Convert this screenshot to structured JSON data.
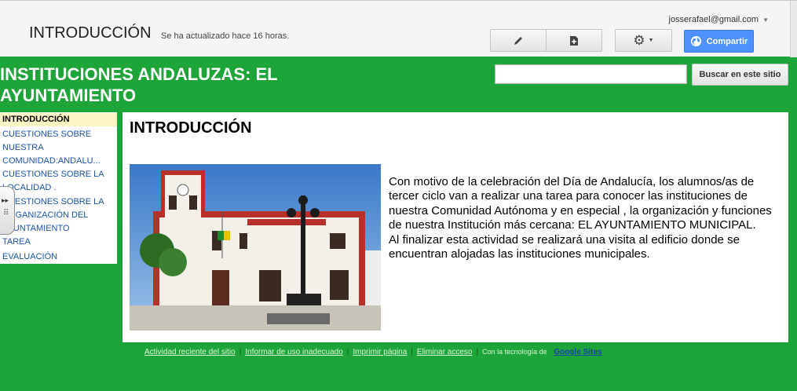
{
  "header": {
    "page_title": "INTRODUCCIÓN",
    "updated_text": "Se ha actualizado hace 16 horas.",
    "user_email": "josserafael@gmail.com",
    "share_label": "Compartir"
  },
  "site": {
    "title": "INSTITUCIONES ANDALUZAS: EL AYUNTAMIENTO",
    "search_button": "Buscar en este sitio",
    "search_value": ""
  },
  "sidebar": {
    "items": [
      {
        "label": "INTRODUCCIÓN",
        "active": true
      },
      {
        "label": "CUESTIONES SOBRE NUESTRA COMUNIDAD:ANDALU..."
      },
      {
        "label": "CUESTIONES SOBRE LA LOCALIDAD ."
      },
      {
        "label": "CUESTIONES SOBRE LA ORGANIZACIÓN DEL AYUNTAMIENTO"
      },
      {
        "label": "TAREA"
      },
      {
        "label": "EVALUACIÓN"
      }
    ]
  },
  "main": {
    "title": "INTRODUCCIÓN",
    "paragraph1": "Con motivo de la celebración del Día de Andalucía, los alumnos/as de tercer ciclo van a realizar una tarea para conocer las instituciones de nuestra Comunidad Autónoma  y en especial  , la organización y funciones de nuestra Institución más cercana:  EL AYUNTAMIENTO MUNICIPAL.",
    "paragraph2": "Al finalizar esta actividad se realizará una visita al edificio donde se encuentran alojadas  las instituciones municipales."
  },
  "footer": {
    "links": [
      "Actividad reciente del sitio",
      "Informar de uso inadecuado",
      "Imprimir página",
      "Eliminar acceso"
    ],
    "powered_by": "Con la tecnología de",
    "brand": "Google Sites"
  },
  "colors": {
    "page_bg": "#1ea53a",
    "share_button": "#4d90fe",
    "active_nav": "#fbf4c3",
    "link": "#1a53a6"
  }
}
